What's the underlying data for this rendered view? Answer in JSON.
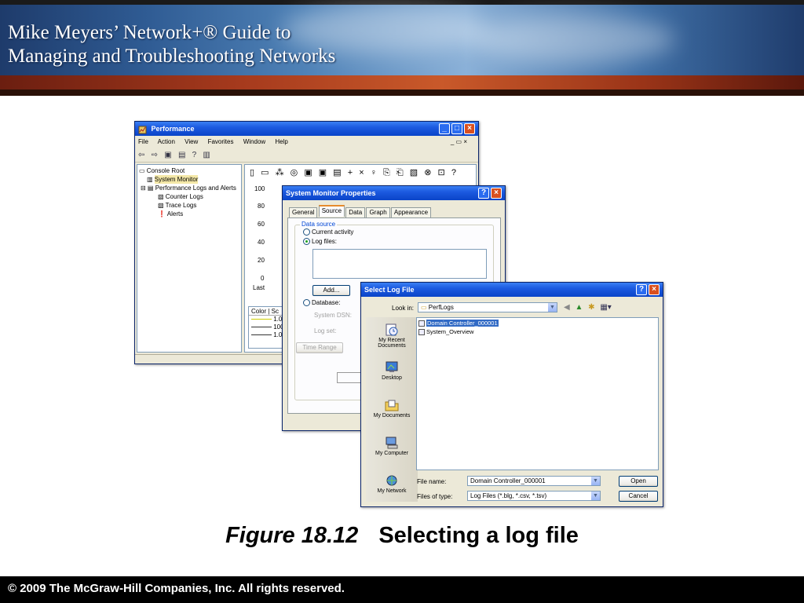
{
  "banner": {
    "title_line1": "Mike Meyers’ Network+® Guide to",
    "title_line2": "Managing and Troubleshooting Networks"
  },
  "footer": {
    "copyright": "© 2009 The McGraw-Hill Companies, Inc. All rights reserved."
  },
  "caption": {
    "figure": "Figure 18.12",
    "text": "Selecting a log file"
  },
  "performance_window": {
    "title": "Performance",
    "menu": [
      "File",
      "Action",
      "View",
      "Favorites",
      "Window",
      "Help"
    ],
    "menu_controls": "_ ▭ ×",
    "toolbar_icons": [
      "back-icon",
      "forward-icon",
      "up-icon",
      "show-hide-icon",
      "help-icon",
      "properties-icon"
    ],
    "toolbar_glyphs": [
      "⇦",
      "⇨",
      "▣",
      "▤",
      "?",
      "▥"
    ],
    "tree": [
      "Console Root",
      "System Monitor",
      "Performance Logs and Alerts",
      "Counter Logs",
      "Trace Logs",
      "Alerts"
    ],
    "graph_toolbar": [
      "▯",
      "▭",
      "⁂",
      "◎",
      "▣",
      "▣",
      "▤",
      "+",
      "×",
      "♀",
      "⎘",
      "⎗",
      "▧",
      "⊗",
      "⊡",
      "?"
    ],
    "y_axis": [
      "100",
      "80",
      "60",
      "40",
      "20",
      "0"
    ],
    "last_label": "Last",
    "legend_headers": [
      "Color",
      "Sc"
    ],
    "legend_rows": [
      "1.0",
      "100",
      "1.0"
    ]
  },
  "properties_dialog": {
    "title": "System Monitor Properties",
    "tabs": [
      "General",
      "Source",
      "Data",
      "Graph",
      "Appearance"
    ],
    "active_tab": "Source",
    "groupbox_label": "Data source",
    "radio_current": "Current activity",
    "radio_log": "Log files:",
    "add_button": "Add...",
    "radio_database": "Database:",
    "system_dsn": "System DSN:",
    "log_set": "Log set:",
    "time_range_button": "Time Range"
  },
  "select_log_dialog": {
    "title": "Select Log File",
    "look_in_label": "Look in:",
    "look_in_value": "PerfLogs",
    "nav_glyphs": [
      "◀",
      "▲",
      "✱",
      "▦▾"
    ],
    "places": [
      "My Recent Documents",
      "Desktop",
      "My Documents",
      "My Computer",
      "My Network"
    ],
    "files": [
      "Domain Controller_000001",
      "System_Overview"
    ],
    "selected_file_index": 0,
    "file_name_label": "File name:",
    "file_name_value": "Domain Controller_000001",
    "file_type_label": "Files of type:",
    "file_type_value": "Log Files (*.blg, *.csv, *.tsv)",
    "open_button": "Open",
    "cancel_button": "Cancel"
  },
  "colors": {
    "xp_title": "#0a44c8",
    "xp_close": "#d9501f",
    "selection": "#316ac5",
    "tab_highlight": "#e68b2c"
  }
}
